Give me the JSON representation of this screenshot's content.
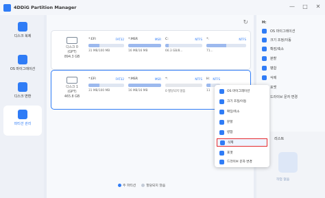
{
  "app": {
    "title": "4DDiG Partition Manager"
  },
  "window_controls": [
    "—",
    "□",
    "✕"
  ],
  "sidebar": {
    "items": [
      {
        "label": "디스크 복제",
        "active": false
      },
      {
        "label": "OS 마이그레이션",
        "active": false
      },
      {
        "label": "디스크 변환",
        "active": false
      },
      {
        "label": "파티션 관리",
        "active": true
      }
    ]
  },
  "disks": [
    {
      "name": "디스크 0",
      "type": "(GPT)",
      "size": "894.3 GB",
      "partitions": [
        {
          "name": "*:EFI",
          "fs": "FAT32",
          "size": "31 MB/100 MB",
          "used": 0.3
        },
        {
          "name": "*:MSR",
          "fs": "MSR",
          "size": "16 MB/16 MB",
          "used": 1.0
        },
        {
          "name": "C:",
          "fs": "NTFS",
          "size": "66.3 GB/8...",
          "used": 0.1
        },
        {
          "name": "*:",
          "fs": "NTFS",
          "size": "71...",
          "used": 0.5
        }
      ]
    },
    {
      "name": "디스크 1",
      "type": "(GPT)",
      "size": "465.8 GB",
      "partitions": [
        {
          "name": "*:EFI",
          "fs": "FAT32",
          "size": "31 MB/100 MB",
          "used": 0.3
        },
        {
          "name": "*:MSR",
          "fs": "MSR",
          "size": "16 MB/16 MB",
          "used": 1.0
        },
        {
          "name": "*:",
          "fs": "NTFS",
          "size": "0 할당되지 않음",
          "used": 0.0
        },
        {
          "name": "H:",
          "fs": "NTFS",
          "size": "11",
          "used": 0.3
        }
      ]
    }
  ],
  "legend": [
    {
      "label": "주 파티션",
      "color": "#2f7cf6"
    },
    {
      "label": "할당되지 않음",
      "color": "#c4ccd8"
    }
  ],
  "right_panel": {
    "header": "H:",
    "actions": [
      "OS 마이그레이션",
      "크기 조정/이동",
      "확장/축소",
      "분할",
      "병합",
      "삭제",
      "포맷",
      "드라이브 문자 변경"
    ],
    "pending_title": "리스트",
    "pending_empty": "작업 없음"
  },
  "context_menu": {
    "items": [
      "OS 마이그레이션",
      "크기 조정/이동",
      "확장/축소",
      "분할",
      "병합",
      "삭제",
      "포맷",
      "드라이브 문자 변경"
    ],
    "highlighted_index": 5
  },
  "colors": {
    "accent": "#2f7cf6",
    "highlight_border": "#e4272b"
  }
}
